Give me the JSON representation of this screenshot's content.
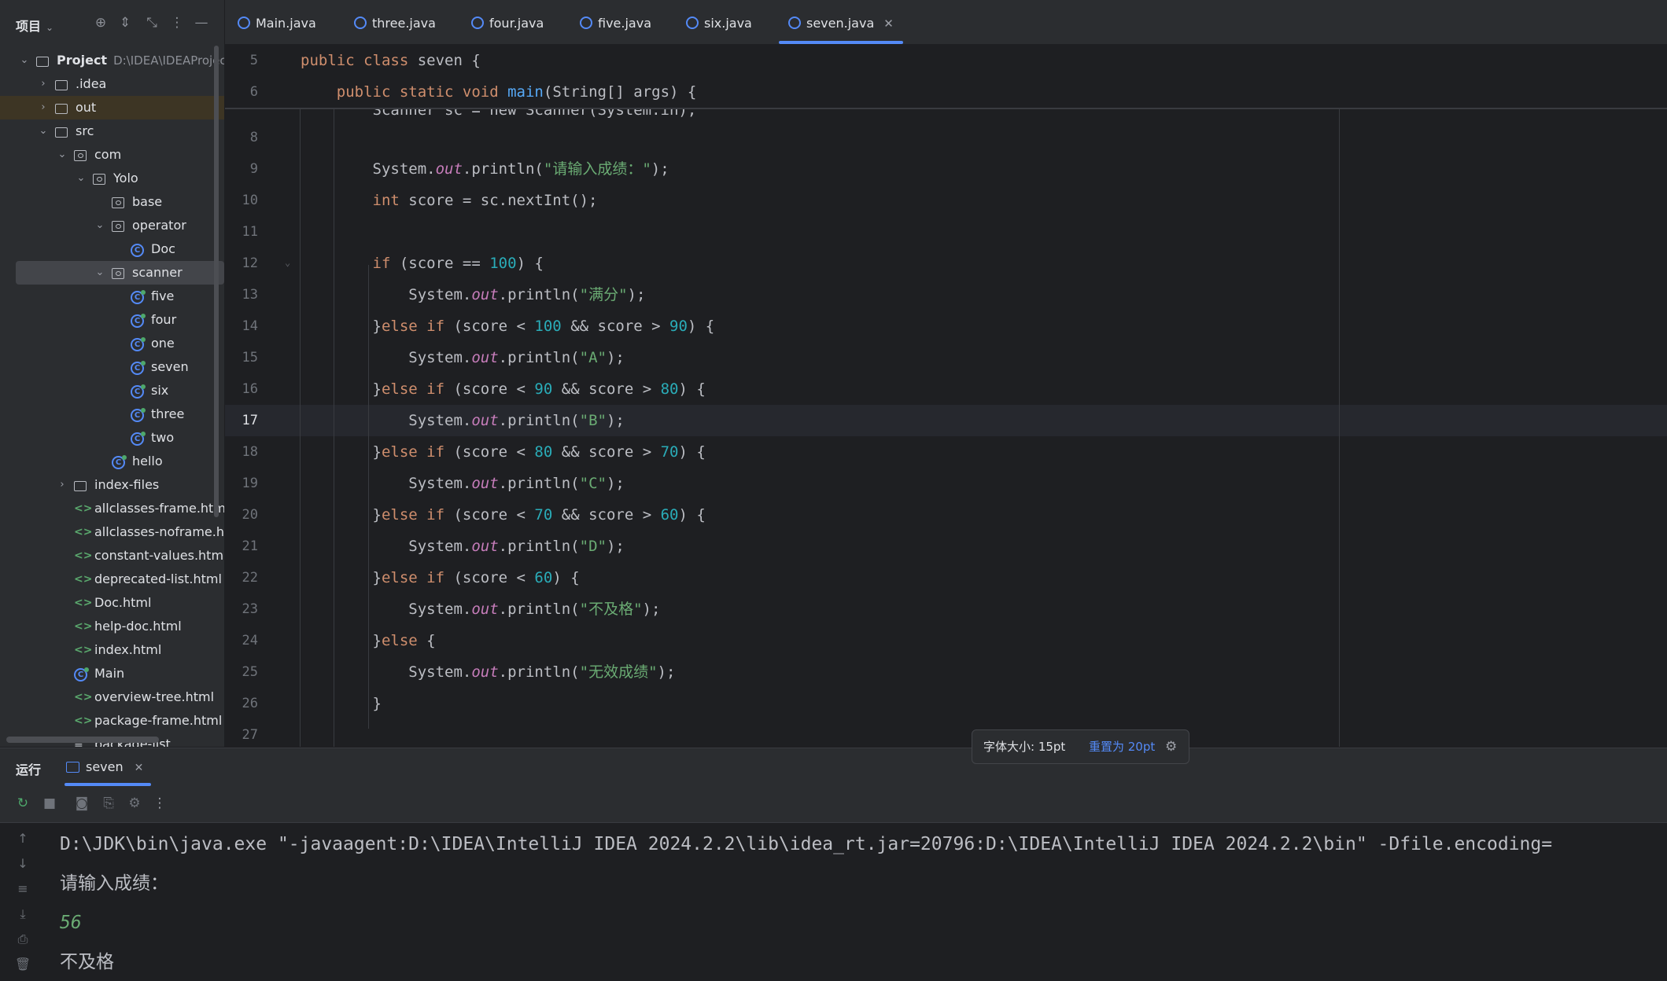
{
  "project_panel": {
    "title": "项目",
    "tree": [
      {
        "label": "Project",
        "path": "D:\\IDEA\\IDEAProject\\",
        "type": "module",
        "depth": 0,
        "arrow": "⌄"
      },
      {
        "label": ".idea",
        "type": "folder",
        "depth": 1,
        "arrow": "›"
      },
      {
        "label": "out",
        "type": "folder",
        "depth": 1,
        "arrow": "›"
      },
      {
        "label": "src",
        "type": "folder",
        "depth": 1,
        "arrow": "⌄"
      },
      {
        "label": "com",
        "type": "package",
        "depth": 2,
        "arrow": "⌄"
      },
      {
        "label": "Yolo",
        "type": "package",
        "depth": 3,
        "arrow": "⌄"
      },
      {
        "label": "base",
        "type": "package",
        "depth": 4,
        "arrow": ""
      },
      {
        "label": "operator",
        "type": "package",
        "depth": 4,
        "arrow": "⌄"
      },
      {
        "label": "Doc",
        "type": "class",
        "depth": 5,
        "arrow": ""
      },
      {
        "label": "scanner",
        "type": "package",
        "depth": 4,
        "arrow": "⌄"
      },
      {
        "label": "five",
        "type": "class-run",
        "depth": 5,
        "arrow": ""
      },
      {
        "label": "four",
        "type": "class-run",
        "depth": 5,
        "arrow": ""
      },
      {
        "label": "one",
        "type": "class-run",
        "depth": 5,
        "arrow": ""
      },
      {
        "label": "seven",
        "type": "class-run",
        "depth": 5,
        "arrow": ""
      },
      {
        "label": "six",
        "type": "class-run",
        "depth": 5,
        "arrow": ""
      },
      {
        "label": "three",
        "type": "class-run",
        "depth": 5,
        "arrow": ""
      },
      {
        "label": "two",
        "type": "class-run",
        "depth": 5,
        "arrow": ""
      },
      {
        "label": "hello",
        "type": "class-run",
        "depth": 4,
        "arrow": ""
      },
      {
        "label": "index-files",
        "type": "folder",
        "depth": 2,
        "arrow": "›"
      },
      {
        "label": "allclasses-frame.html",
        "type": "html",
        "depth": 2,
        "arrow": ""
      },
      {
        "label": "allclasses-noframe.htm",
        "type": "html",
        "depth": 2,
        "arrow": ""
      },
      {
        "label": "constant-values.html",
        "type": "html",
        "depth": 2,
        "arrow": ""
      },
      {
        "label": "deprecated-list.html",
        "type": "html",
        "depth": 2,
        "arrow": ""
      },
      {
        "label": "Doc.html",
        "type": "html",
        "depth": 2,
        "arrow": ""
      },
      {
        "label": "help-doc.html",
        "type": "html",
        "depth": 2,
        "arrow": ""
      },
      {
        "label": "index.html",
        "type": "html",
        "depth": 2,
        "arrow": ""
      },
      {
        "label": "Main",
        "type": "class-run",
        "depth": 2,
        "arrow": ""
      },
      {
        "label": "overview-tree.html",
        "type": "html",
        "depth": 2,
        "arrow": ""
      },
      {
        "label": "package-frame.html",
        "type": "html",
        "depth": 2,
        "arrow": ""
      },
      {
        "label": "package-list",
        "type": "list",
        "depth": 2,
        "arrow": ""
      }
    ]
  },
  "tabs": [
    {
      "label": "Main.java",
      "active": false
    },
    {
      "label": "three.java",
      "active": false
    },
    {
      "label": "four.java",
      "active": false
    },
    {
      "label": "five.java",
      "active": false
    },
    {
      "label": "six.java",
      "active": false
    },
    {
      "label": "seven.java",
      "active": true
    }
  ],
  "editor": {
    "sticky_lines": [
      {
        "n": "5",
        "tokens": [
          [
            "kw",
            "public class "
          ],
          [
            "p",
            "seven {"
          ]
        ]
      },
      {
        "n": "6",
        "tokens": [
          [
            "kw",
            "    public static void "
          ],
          [
            "fn",
            "main"
          ],
          [
            "p",
            "(String[] args) {"
          ]
        ]
      }
    ],
    "ghost_text": "        Scanner sc = new Scanner(System.in);",
    "current_line": "17",
    "lines": [
      {
        "n": "8",
        "tokens": []
      },
      {
        "n": "9",
        "tokens": [
          [
            "p",
            "        System."
          ],
          [
            "stat",
            "out"
          ],
          [
            "p",
            ".println("
          ],
          [
            "str",
            "\"请输入成绩：\""
          ],
          [
            "p",
            ");"
          ]
        ]
      },
      {
        "n": "10",
        "tokens": [
          [
            "kw",
            "        int "
          ],
          [
            "p",
            "score = sc.nextInt();"
          ]
        ]
      },
      {
        "n": "11",
        "tokens": []
      },
      {
        "n": "12",
        "tokens": [
          [
            "kw",
            "        if "
          ],
          [
            "p",
            "(score == "
          ],
          [
            "num",
            "100"
          ],
          [
            "p",
            ") {"
          ]
        ]
      },
      {
        "n": "13",
        "tokens": [
          [
            "p",
            "            System."
          ],
          [
            "stat",
            "out"
          ],
          [
            "p",
            ".println("
          ],
          [
            "str",
            "\"满分\""
          ],
          [
            "p",
            ");"
          ]
        ]
      },
      {
        "n": "14",
        "tokens": [
          [
            "p",
            "        }"
          ],
          [
            "kw",
            "else if "
          ],
          [
            "p",
            "(score < "
          ],
          [
            "num",
            "100"
          ],
          [
            "p",
            " && score > "
          ],
          [
            "num",
            "90"
          ],
          [
            "p",
            ") {"
          ]
        ]
      },
      {
        "n": "15",
        "tokens": [
          [
            "p",
            "            System."
          ],
          [
            "stat",
            "out"
          ],
          [
            "p",
            ".println("
          ],
          [
            "str",
            "\"A\""
          ],
          [
            "p",
            ");"
          ]
        ]
      },
      {
        "n": "16",
        "tokens": [
          [
            "p",
            "        }"
          ],
          [
            "kw",
            "else if "
          ],
          [
            "p",
            "(score < "
          ],
          [
            "num",
            "90"
          ],
          [
            "p",
            " && score > "
          ],
          [
            "num",
            "80"
          ],
          [
            "p",
            ") {"
          ]
        ]
      },
      {
        "n": "17",
        "tokens": [
          [
            "p",
            "            System."
          ],
          [
            "stat",
            "out"
          ],
          [
            "p",
            ".println("
          ],
          [
            "str",
            "\"B\""
          ],
          [
            "p",
            ");"
          ]
        ]
      },
      {
        "n": "18",
        "tokens": [
          [
            "p",
            "        }"
          ],
          [
            "kw",
            "else if "
          ],
          [
            "p",
            "(score < "
          ],
          [
            "num",
            "80"
          ],
          [
            "p",
            " && score > "
          ],
          [
            "num",
            "70"
          ],
          [
            "p",
            ") {"
          ]
        ]
      },
      {
        "n": "19",
        "tokens": [
          [
            "p",
            "            System."
          ],
          [
            "stat",
            "out"
          ],
          [
            "p",
            ".println("
          ],
          [
            "str",
            "\"C\""
          ],
          [
            "p",
            ");"
          ]
        ]
      },
      {
        "n": "20",
        "tokens": [
          [
            "p",
            "        }"
          ],
          [
            "kw",
            "else if "
          ],
          [
            "p",
            "(score < "
          ],
          [
            "num",
            "70"
          ],
          [
            "p",
            " && score > "
          ],
          [
            "num",
            "60"
          ],
          [
            "p",
            ") {"
          ]
        ]
      },
      {
        "n": "21",
        "tokens": [
          [
            "p",
            "            System."
          ],
          [
            "stat",
            "out"
          ],
          [
            "p",
            ".println("
          ],
          [
            "str",
            "\"D\""
          ],
          [
            "p",
            ");"
          ]
        ]
      },
      {
        "n": "22",
        "tokens": [
          [
            "p",
            "        }"
          ],
          [
            "kw",
            "else if "
          ],
          [
            "p",
            "(score < "
          ],
          [
            "num",
            "60"
          ],
          [
            "p",
            ") {"
          ]
        ]
      },
      {
        "n": "23",
        "tokens": [
          [
            "p",
            "            System."
          ],
          [
            "stat",
            "out"
          ],
          [
            "p",
            ".println("
          ],
          [
            "str",
            "\"不及格\""
          ],
          [
            "p",
            ");"
          ]
        ]
      },
      {
        "n": "24",
        "tokens": [
          [
            "p",
            "        }"
          ],
          [
            "kw",
            "else "
          ],
          [
            "p",
            "{"
          ]
        ]
      },
      {
        "n": "25",
        "tokens": [
          [
            "p",
            "            System."
          ],
          [
            "stat",
            "out"
          ],
          [
            "p",
            ".println("
          ],
          [
            "str",
            "\"无效成绩\""
          ],
          [
            "p",
            ");"
          ]
        ]
      },
      {
        "n": "26",
        "tokens": [
          [
            "p",
            "        }"
          ]
        ]
      },
      {
        "n": "27",
        "tokens": []
      }
    ]
  },
  "font_popup": {
    "font_size": "字体大小: 15pt",
    "reset_label": "重置为 20pt"
  },
  "run_panel": {
    "title": "运行",
    "tab_label": "seven",
    "console_lines": [
      {
        "text": "D:\\JDK\\bin\\java.exe \"-javaagent:D:\\IDEA\\IntelliJ IDEA 2024.2.2\\lib\\idea_rt.jar=20796:D:\\IDEA\\IntelliJ IDEA 2024.2.2\\bin\" -Dfile.encoding=",
        "kind": "cmd"
      },
      {
        "text": "请输入成绩：",
        "kind": "out"
      },
      {
        "text": "56",
        "kind": "input"
      },
      {
        "text": "不及格",
        "kind": "out"
      }
    ]
  },
  "colors": {
    "accent": "#548af7",
    "keyword": "#cf8e6d",
    "string": "#6aab73",
    "number": "#2aacb8",
    "static_field": "#c77dbb",
    "method": "#56a8f5"
  }
}
